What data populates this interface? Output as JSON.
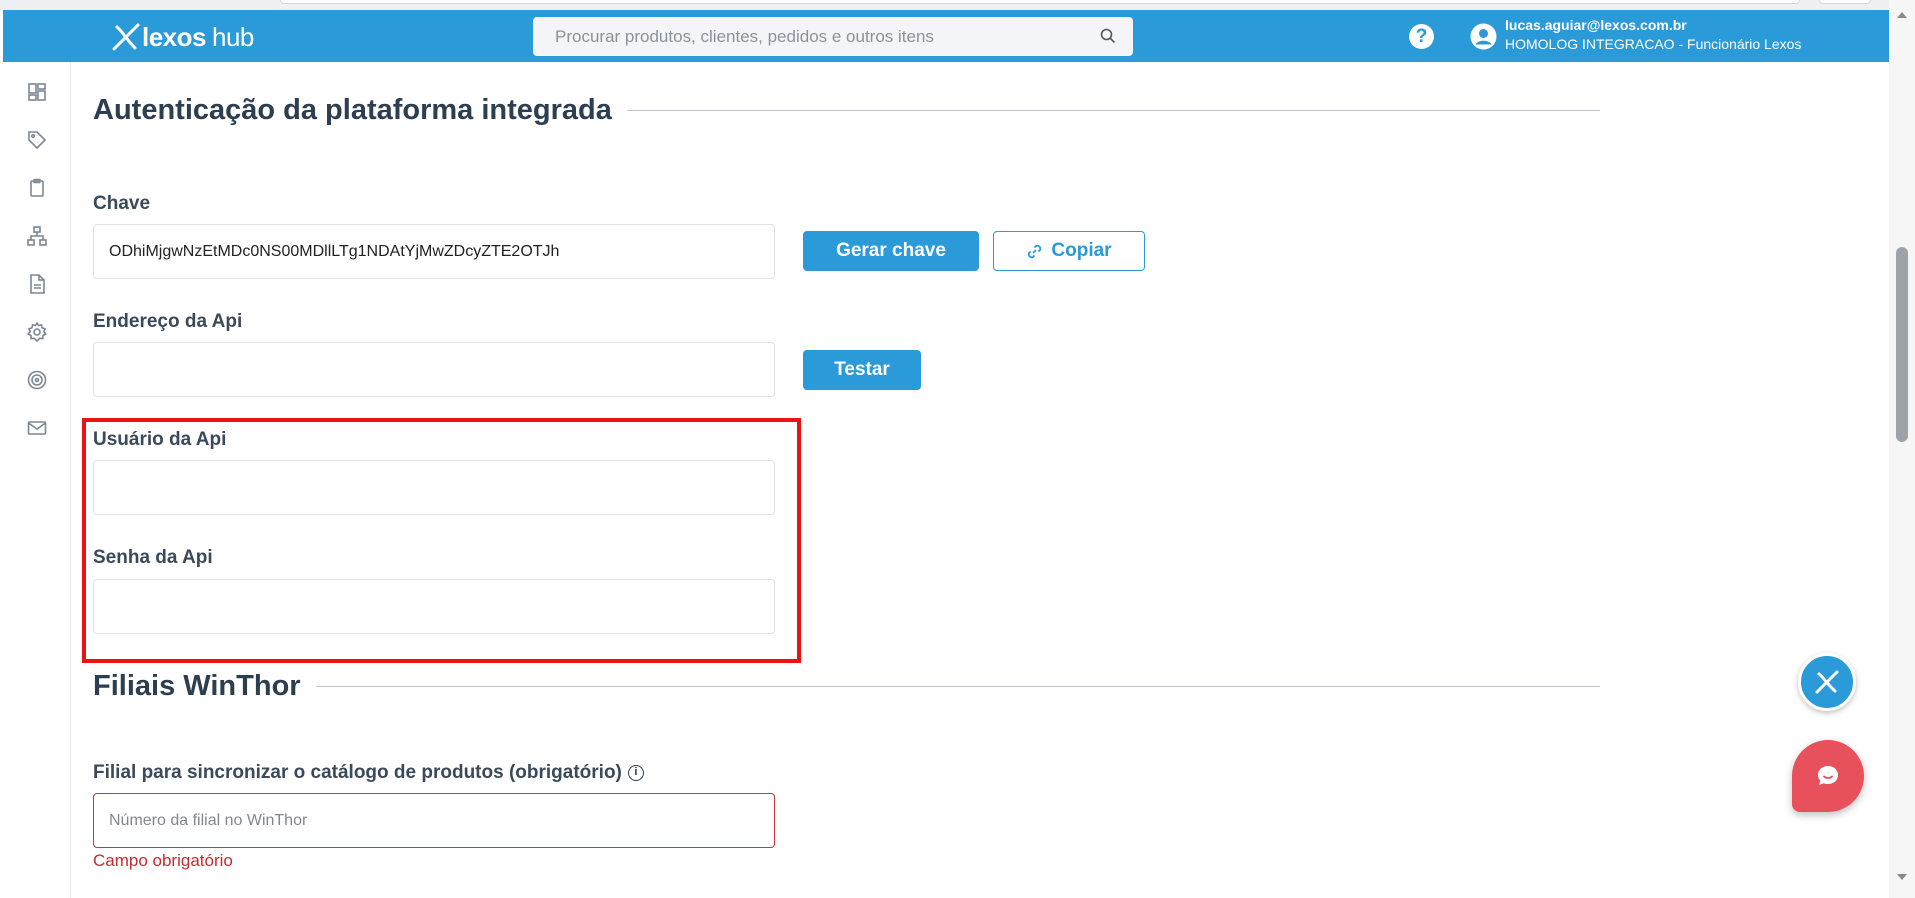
{
  "header": {
    "brand_name": "lexos",
    "brand_suffix": "hub",
    "search_placeholder": "Procurar produtos, clientes, pedidos e outros itens",
    "user_email": "lucas.aguiar@lexos.com.br",
    "user_org": "HOMOLOG INTEGRACAO - Funcionário Lexos"
  },
  "sidebar": {
    "icons": [
      "dashboard-icon",
      "tag-icon",
      "clipboard-icon",
      "network-icon",
      "document-icon",
      "gear-icon",
      "target-icon",
      "mail-icon"
    ]
  },
  "auth_section": {
    "title": "Autenticação da plataforma integrada",
    "key_label": "Chave",
    "key_value": "ODhiMjgwNzEtMDc0NS00MDllLTg1NDAtYjMwZDcyZTE2OTJh",
    "generate_key_button": "Gerar chave",
    "copy_button": "Copiar",
    "api_address_label": "Endereço da Api",
    "api_address_value": "",
    "test_button": "Testar",
    "api_user_label": "Usuário da Api",
    "api_user_value": "",
    "api_password_label": "Senha da Api",
    "api_password_value": ""
  },
  "branches_section": {
    "title": "Filiais WinThor",
    "catalog_branch_label": "Filial para sincronizar o catálogo de produtos (obrigatório)",
    "catalog_branch_placeholder": "Número da filial no WinThor",
    "catalog_branch_error": "Campo obrigatório"
  },
  "colors": {
    "primary": "#2a9ad8",
    "highlight": "#ee1111",
    "error": "#c72b32",
    "chat": "#e8505b"
  }
}
